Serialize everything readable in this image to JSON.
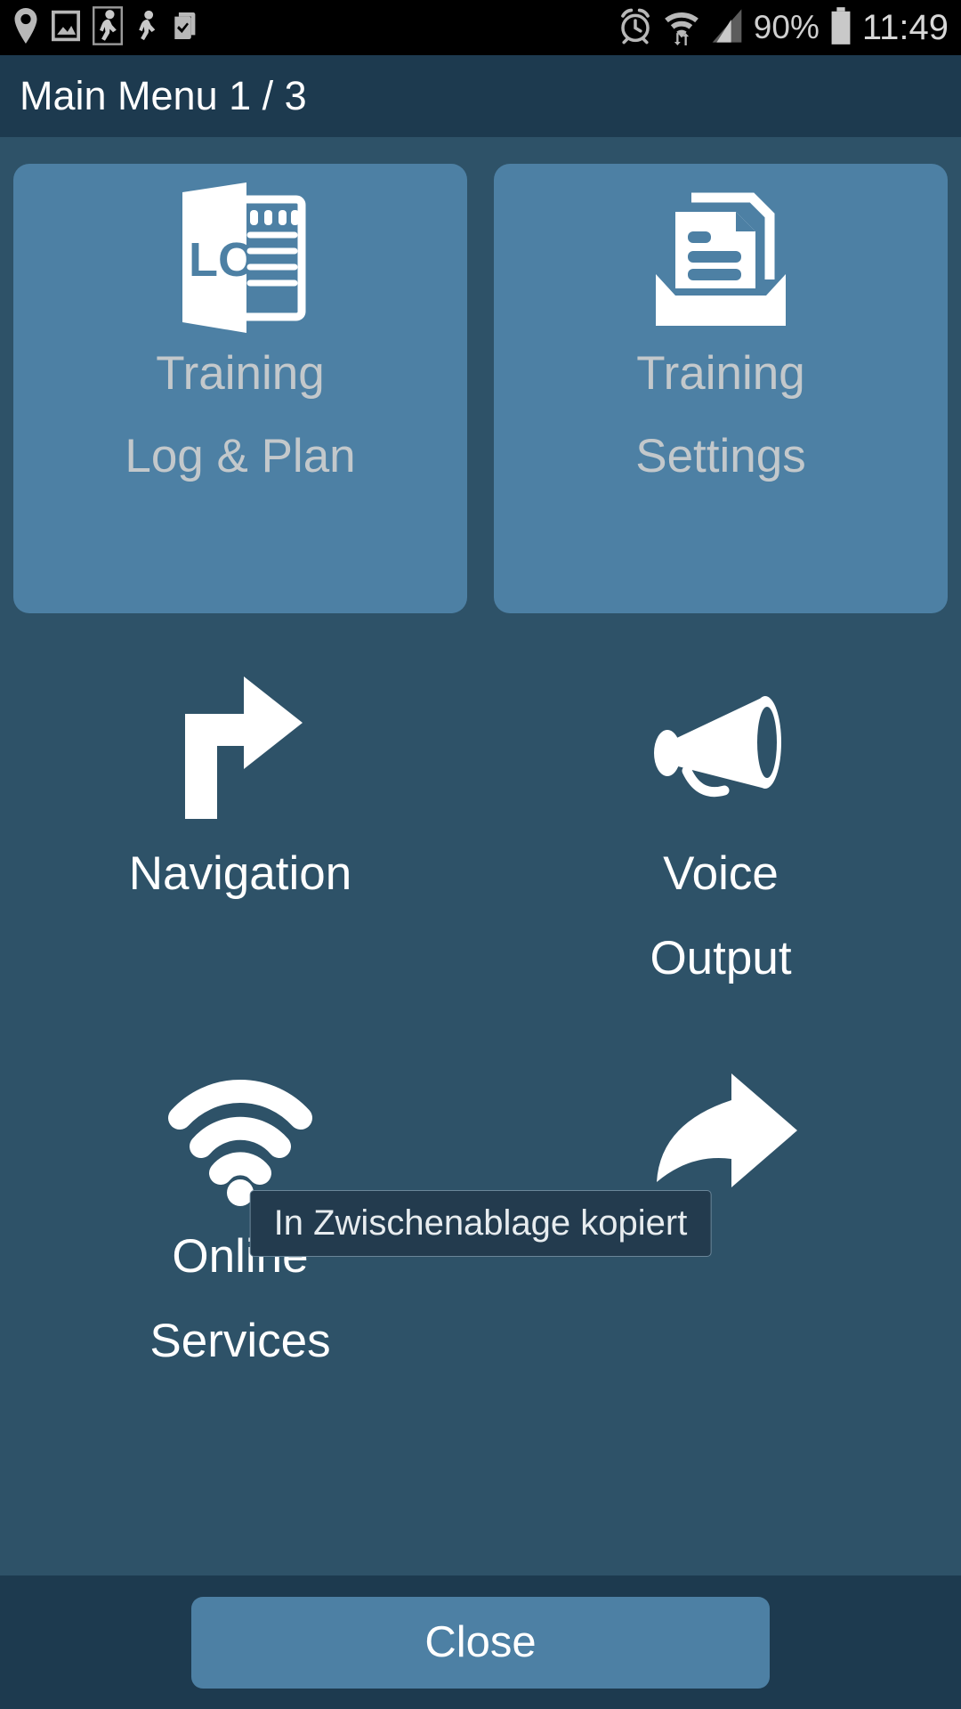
{
  "statusbar": {
    "icons_left": [
      {
        "name": "location-pin-icon"
      },
      {
        "name": "gallery-image-icon"
      },
      {
        "name": "walking-person-boxed-icon"
      },
      {
        "name": "walking-person-icon"
      },
      {
        "name": "clipboard-check-icon"
      }
    ],
    "icons_right": [
      {
        "name": "alarm-clock-icon"
      },
      {
        "name": "wifi-transfer-icon"
      },
      {
        "name": "signal-bars-icon"
      }
    ],
    "battery_percent": "90%",
    "battery_icon": "battery-icon",
    "clock": "11:49"
  },
  "titlebar": {
    "title": "Main Menu 1 / 3"
  },
  "menu": {
    "tiles": [
      {
        "icon": "log-book-notepad-icon",
        "line1": "Training",
        "line2": "Log & Plan",
        "highlighted": true
      },
      {
        "icon": "document-tray-icon",
        "line1": "Training",
        "line2": "Settings",
        "highlighted": true
      }
    ],
    "items": [
      {
        "icon": "turn-right-arrow-icon",
        "line1": "Navigation",
        "line2": ""
      },
      {
        "icon": "megaphone-icon",
        "line1": "Voice",
        "line2": "Output"
      },
      {
        "icon": "wifi-icon",
        "line1": "Online",
        "line2": "Services"
      },
      {
        "icon": "forward-arrow-icon",
        "line1": "",
        "line2": ""
      }
    ]
  },
  "toast": {
    "message": "In Zwischenablage kopiert"
  },
  "bottombar": {
    "close_label": "Close"
  },
  "colors": {
    "statusbar_bg": "#000000",
    "titlebar_bg": "#1d3a4f",
    "body_bg": "#2e5268",
    "tile_bg": "#4d80a4",
    "tile_label": "#c3c8cb",
    "item_label": "#ffffff",
    "toast_bg": "#233b4e",
    "toast_border": "#6b8699",
    "button_bg": "#4d80a4"
  }
}
